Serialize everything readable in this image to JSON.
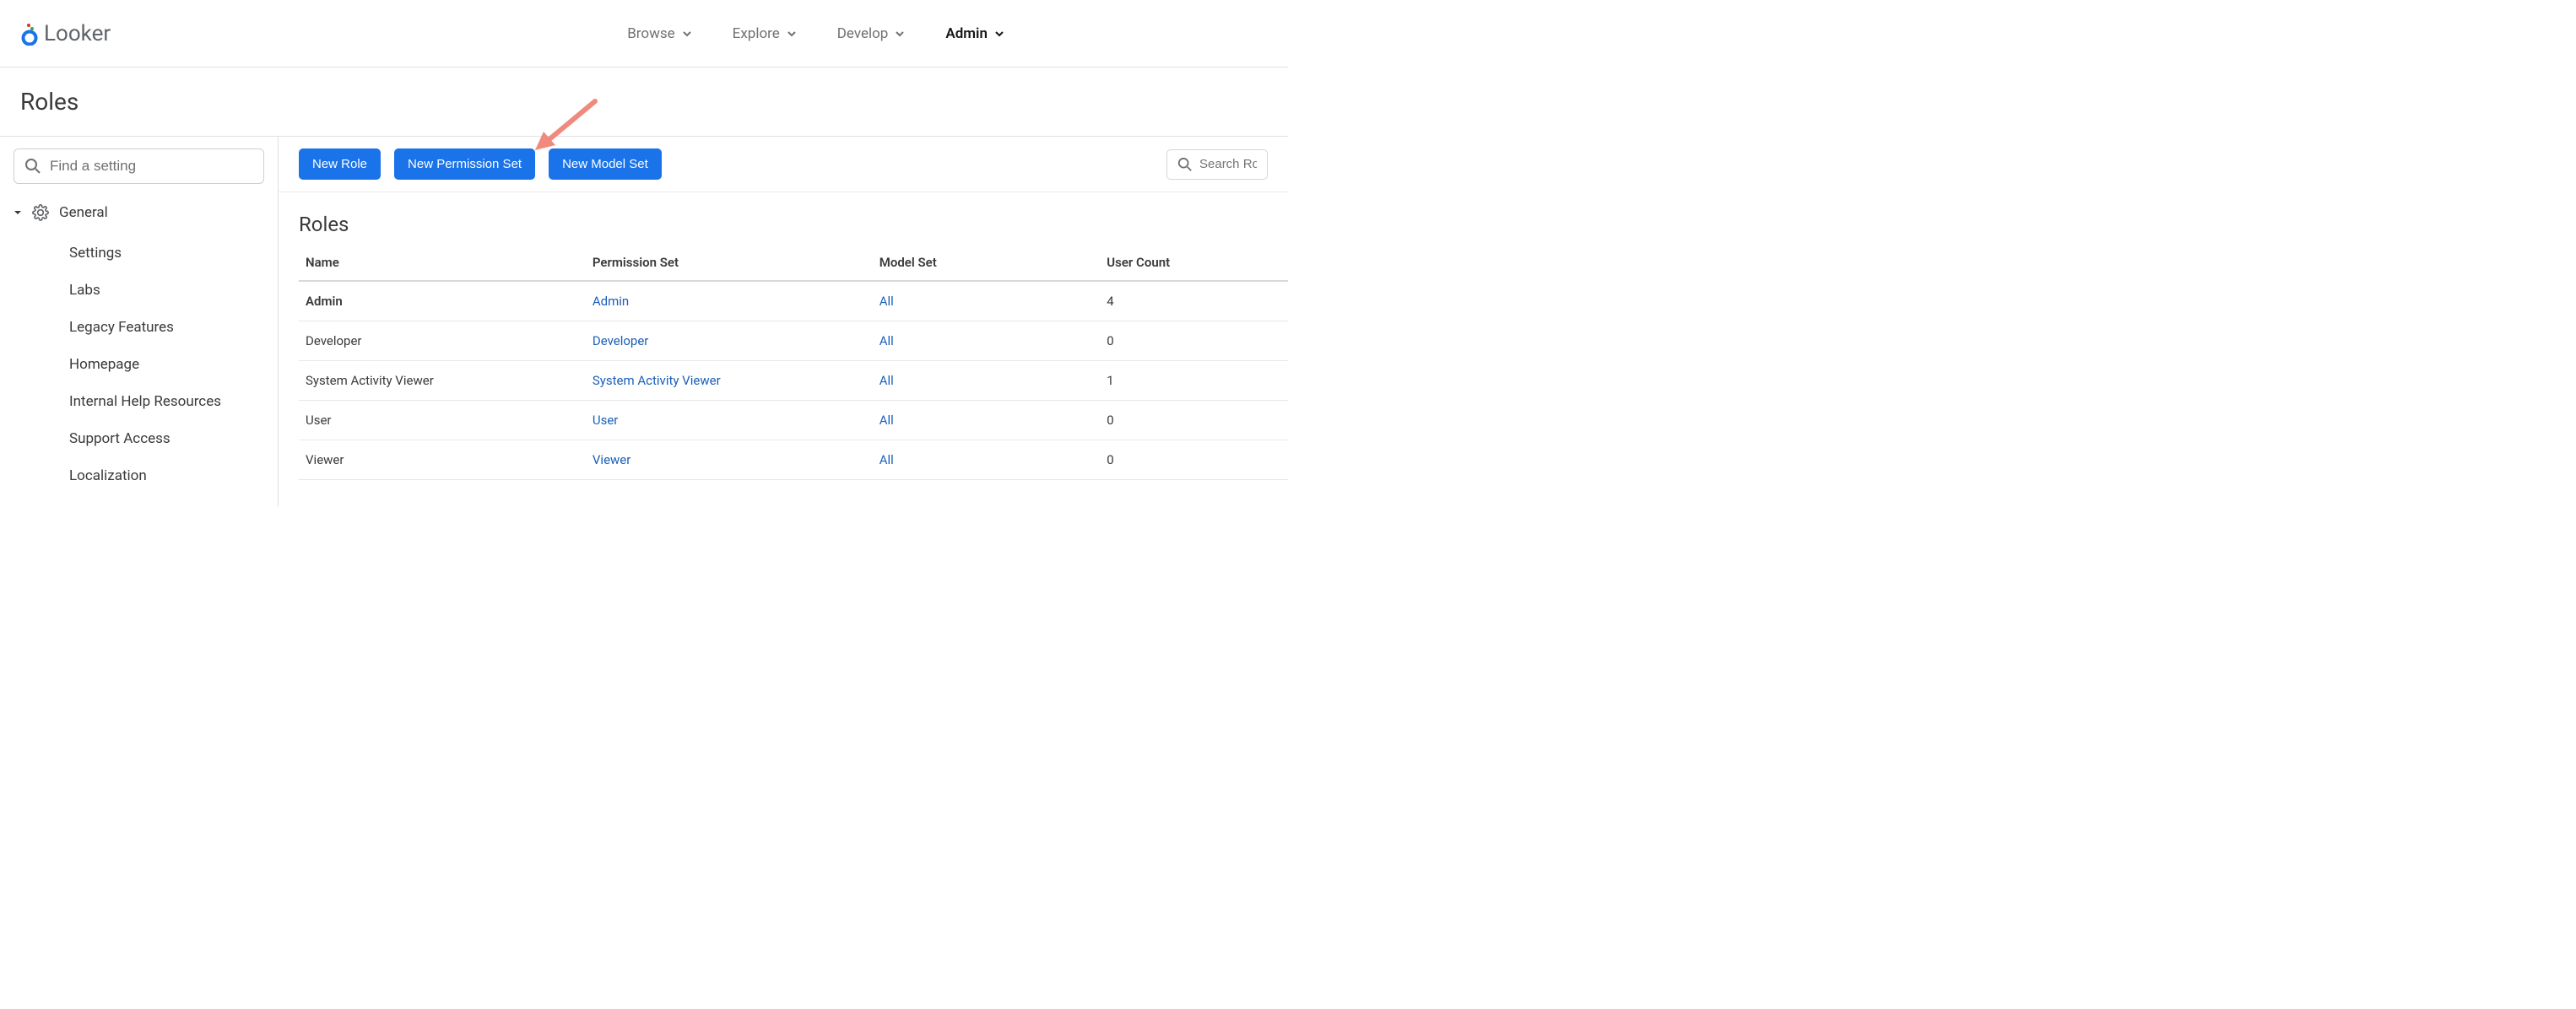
{
  "brand": "Looker",
  "nav": {
    "items": [
      {
        "label": "Browse",
        "active": false
      },
      {
        "label": "Explore",
        "active": false
      },
      {
        "label": "Develop",
        "active": false
      },
      {
        "label": "Admin",
        "active": true
      }
    ]
  },
  "page_title": "Roles",
  "sidebar": {
    "search_placeholder": "Find a setting",
    "group_label": "General",
    "items": [
      "Settings",
      "Labs",
      "Legacy Features",
      "Homepage",
      "Internal Help Resources",
      "Support Access",
      "Localization"
    ]
  },
  "actions": {
    "new_role": "New Role",
    "new_permission_set": "New Permission Set",
    "new_model_set": "New Model Set",
    "search_placeholder": "Search Roles, Pe"
  },
  "section_title": "Roles",
  "table": {
    "headers": [
      "Name",
      "Permission Set",
      "Model Set",
      "User Count"
    ],
    "rows": [
      {
        "name": "Admin",
        "name_bold": true,
        "permission_set": "Admin",
        "model_set": "All",
        "user_count": "4"
      },
      {
        "name": "Developer",
        "name_bold": false,
        "permission_set": "Developer",
        "model_set": "All",
        "user_count": "0"
      },
      {
        "name": "System Activity Viewer",
        "name_bold": false,
        "permission_set": "System Activity Viewer",
        "model_set": "All",
        "user_count": "1"
      },
      {
        "name": "User",
        "name_bold": false,
        "permission_set": "User",
        "model_set": "All",
        "user_count": "0"
      },
      {
        "name": "Viewer",
        "name_bold": false,
        "permission_set": "Viewer",
        "model_set": "All",
        "user_count": "0"
      }
    ]
  },
  "colors": {
    "primary_button": "#1a73e8",
    "link": "#1a5fb8",
    "annotation_arrow": "#f08a7d"
  }
}
